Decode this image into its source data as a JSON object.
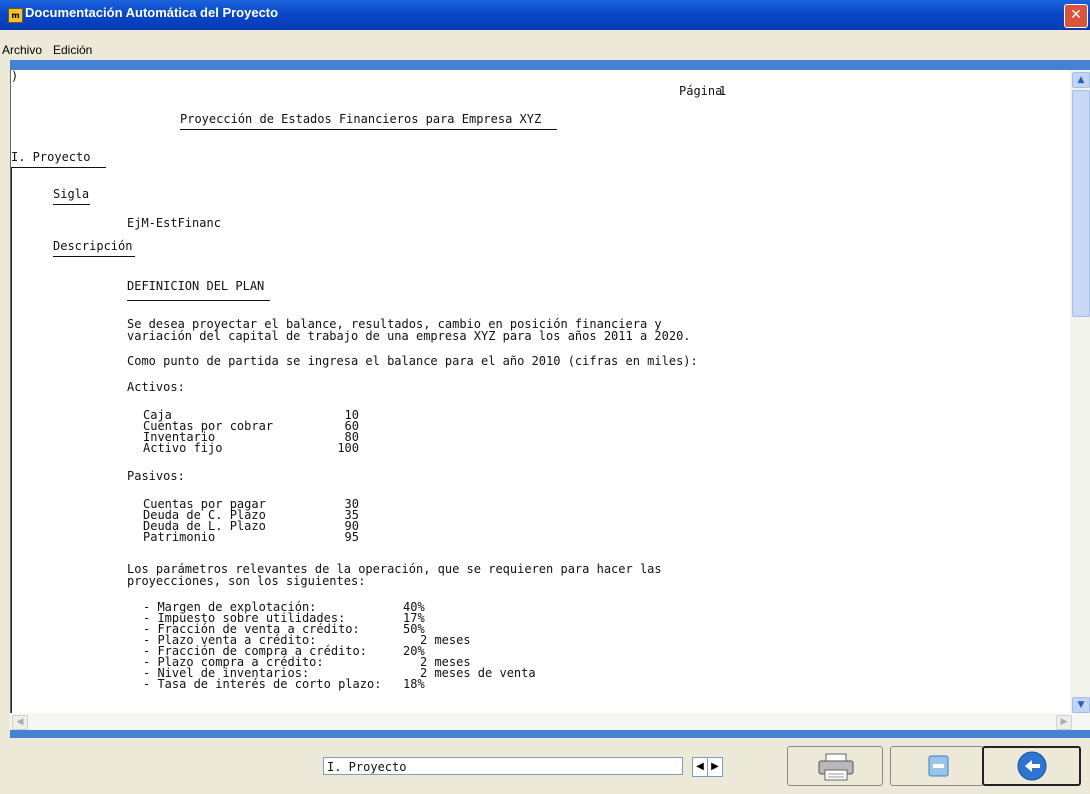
{
  "window": {
    "title": "Documentación Automática del Proyecto",
    "icon_text": "m",
    "close_label": "✕"
  },
  "menu": {
    "items": [
      "Archivo",
      "Edición"
    ]
  },
  "document": {
    "cursor_mark": ")",
    "page_label": "Página",
    "page_number": "1",
    "title": "Proyección de Estados Financieros para Empresa XYZ",
    "section": "I. Proyecto",
    "sigla_heading": "Sigla",
    "sigla_value": "EjM-EstFinanc",
    "descripcion_heading": "Descripción",
    "plan_heading": "DEFINICION DEL PLAN",
    "para1_line1": "Se desea proyectar el balance, resultados, cambio en posición financiera y",
    "para1_line2": "variación del capital de trabajo de una empresa XYZ para los años 2011 a 2020.",
    "para2": "Como punto de partida se ingresa el balance para el año 2010 (cifras en miles):",
    "activos_heading": "Activos:",
    "activos": [
      {
        "name": "Caja",
        "value": "10"
      },
      {
        "name": "Cuentas por cobrar",
        "value": "60"
      },
      {
        "name": "Inventario",
        "value": "80"
      },
      {
        "name": "Activo fijo",
        "value": "100"
      }
    ],
    "pasivos_heading": "Pasivos:",
    "pasivos": [
      {
        "name": "Cuentas por pagar",
        "value": "30"
      },
      {
        "name": "Deuda de C. Plazo",
        "value": "35"
      },
      {
        "name": "Deuda de L. Plazo",
        "value": "90"
      },
      {
        "name": "Patrimonio",
        "value": "95"
      }
    ],
    "para3_line1": "Los parámetros relevantes de la operación, que se requieren para hacer las",
    "para3_line2": "proyecciones, son los siguientes:",
    "parametros": [
      {
        "name": "- Margen de explotación:",
        "value": "40%"
      },
      {
        "name": "- Impuesto sobre utilidades:",
        "value": "17%"
      },
      {
        "name": "- Fracción de venta a crédito:",
        "value": "50%"
      },
      {
        "name": "- Plazo venta a crédito:",
        "value": "2 meses"
      },
      {
        "name": "- Fracción de compra a crédito:",
        "value": "20%"
      },
      {
        "name": "- Plazo compra a crédito:",
        "value": "2 meses"
      },
      {
        "name": "- Nivel de inventarios:",
        "value": "2 meses de venta"
      },
      {
        "name": "- Tasa de interés de corto plazo:",
        "value": "18%"
      }
    ]
  },
  "scroll": {
    "up": "▲",
    "down": "▼",
    "left": "◀",
    "right": "▶"
  },
  "bottom": {
    "nav_value": "I. Proyecto",
    "prev": "◀",
    "next": "▶"
  },
  "colors": {
    "titlebar": "#0a47c8",
    "accent_bar": "#4682d2",
    "background": "#ece9d8"
  }
}
